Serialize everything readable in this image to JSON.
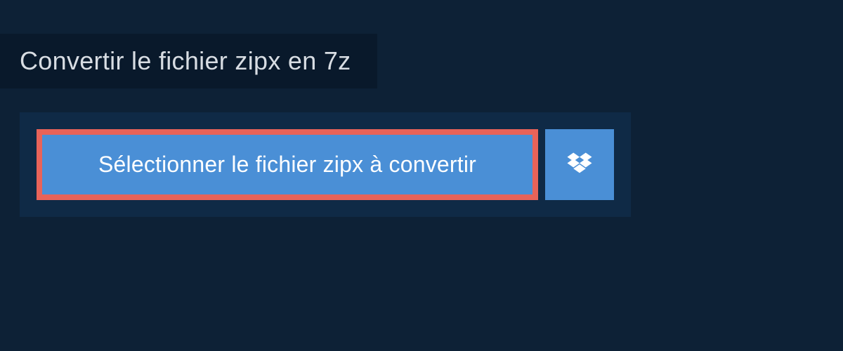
{
  "header": {
    "title": "Convertir le fichier zipx en 7z"
  },
  "actions": {
    "select_file_label": "Sélectionner le fichier zipx à convertir",
    "dropbox_icon": "dropbox-icon"
  }
}
